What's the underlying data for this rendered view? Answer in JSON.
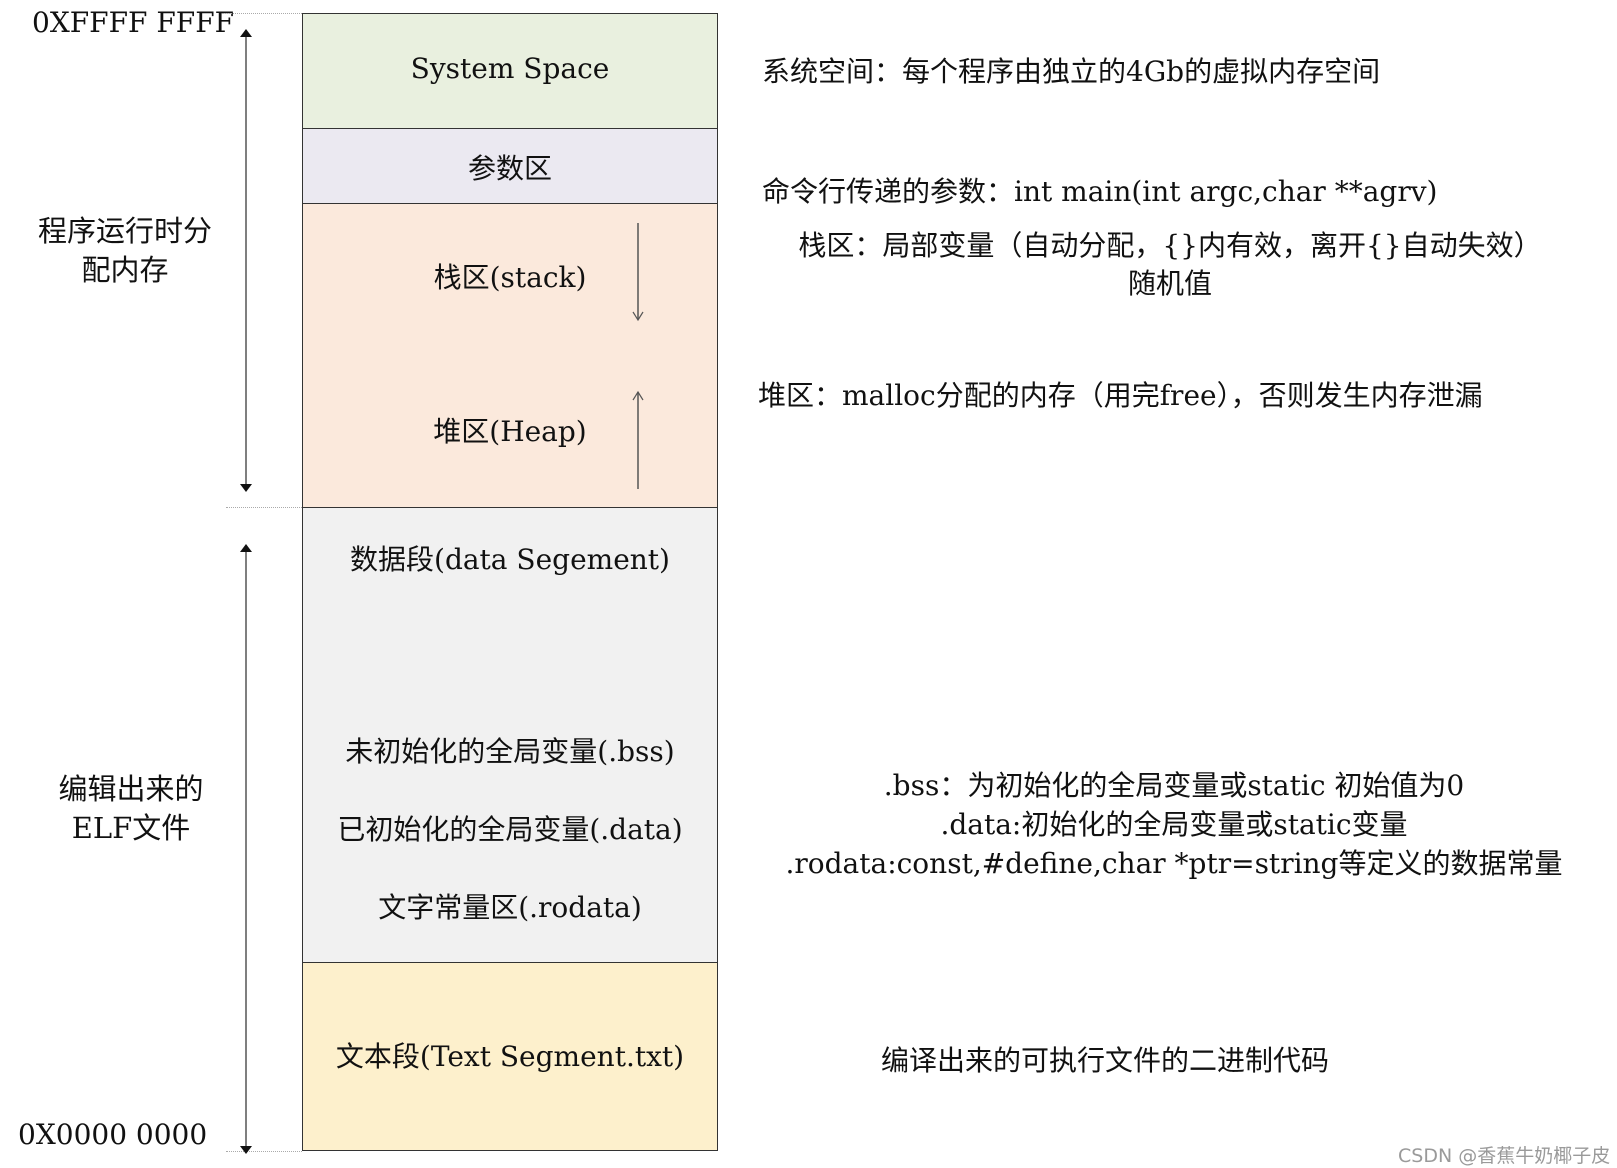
{
  "addresses": {
    "top": "0XFFFF FFFF",
    "bottom": "0X0000 0000"
  },
  "side_labels": {
    "runtime": [
      "程序运行时分",
      "配内存"
    ],
    "elf": [
      "编辑出来的",
      "ELF文件"
    ]
  },
  "segments": [
    {
      "id": "system",
      "label": "System Space",
      "color": "#e9f0df"
    },
    {
      "id": "args",
      "label": "参数区",
      "color": "#ebe9f1"
    },
    {
      "id": "stack_heap",
      "stack_label": "栈区(stack)",
      "heap_label": "堆区(Heap)",
      "stack_direction": "down",
      "heap_direction": "up",
      "color": "#fbe9dc"
    },
    {
      "id": "data",
      "title": "数据段(data Segement)",
      "lines": [
        "未初始化的全局变量(.bss)",
        "已初始化的全局变量(.data)",
        "文字常量区(.rodata)"
      ],
      "color": "#f1f1f1"
    },
    {
      "id": "text",
      "label": "文本段(Text Segment.txt)",
      "color": "#fdf0cc"
    }
  ],
  "descriptions": {
    "system": "系统空间：每个程序由独立的4Gb的虚拟内存空间",
    "args": "命令行传递的参数：int main(int argc,char **agrv)",
    "stack": [
      "栈区：局部变量（自动分配，{}内有效，离开{}自动失效）",
      "随机值"
    ],
    "heap": "堆区：malloc分配的内存（用完free），否则发生内存泄漏",
    "data": [
      ".bss：为初始化的全局变量或static  初始值为0",
      ".data:初始化的全局变量或static变量",
      ".rodata:const,#define,char *ptr=string等定义的数据常量"
    ],
    "text": "编译出来的可执行文件的二进制代码"
  },
  "watermark": "CSDN @香蕉牛奶椰子皮"
}
